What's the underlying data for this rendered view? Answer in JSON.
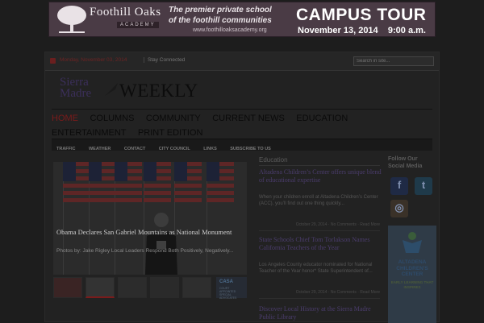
{
  "banner": {
    "brand": "Foothill Oaks",
    "brand_sub": "ACADEMY",
    "tagline_1": "The premier private school",
    "tagline_2": "of the foothill communities",
    "url": "www.foothilloaksacademy.org",
    "headline": "CAMPUS TOUR",
    "date": "November 13, 2014",
    "time": "9:00 a.m."
  },
  "topbar": {
    "date": "Monday, November 03, 2014",
    "stay_connected": "Stay Connected",
    "search_placeholder": "Search in site..."
  },
  "logo": {
    "sierra": "Sierra",
    "madre": "Madre",
    "weekly": "WEEKLY"
  },
  "nav": {
    "items": [
      "HOME",
      "COLUMNS",
      "COMMUNITY",
      "CURRENT NEWS",
      "EDUCATION",
      "ENTERTAINMENT",
      "PRINT EDITION"
    ]
  },
  "subnav": {
    "items": [
      "TRAFFIC",
      "WEATHER",
      "CONTACT",
      "CITY COUNCIL",
      "LINKS",
      "SUBSCRIBE TO US"
    ]
  },
  "feature": {
    "title": "Obama Declares San Gabriel Mountains as National Monument",
    "excerpt": "Photos by: Jake Rigley Local Leaders Respond Both Positively, Negatively..."
  },
  "thumbs": {
    "casa_title": "CASA",
    "casa_sub": "COURT APPOINTED SPECIAL ADVOCATES"
  },
  "education": {
    "heading": "Education",
    "articles": [
      {
        "title": "Altadena Children’s Center offers unique blend of educational expertise",
        "excerpt": "When your children enroll at Altadena Children’s Center (ACC), you’ll find out one thing quickly...",
        "meta": "October 29, 2014  ·  No Comments  ·  Read More"
      },
      {
        "title": "State Schools Chief Tom Torlakson Names California Teachers of the Year",
        "excerpt": "Los Angeles County educator nominated for National Teacher of the Year honor* State Superintendent of...",
        "meta": "October 29, 2014  ·  No Comments  ·  Read More"
      },
      {
        "title": "Discover Local History at the Sierra Madre Public Library",
        "excerpt": "",
        "meta": ""
      }
    ]
  },
  "social": {
    "heading_1": "Follow Our",
    "heading_2": "Social Media",
    "facebook_glyph": "f",
    "twitter_glyph": "t",
    "instagram_glyph": "◎"
  },
  "side_ad": {
    "title": "ALTADENA CHILDREN'S CENTER",
    "sub": "EARLY LEARNING THAT INSPIRES"
  },
  "colors": {
    "accent": "#7a1b1b",
    "link": "#4b3d6d",
    "background": "#1d1d1d"
  }
}
